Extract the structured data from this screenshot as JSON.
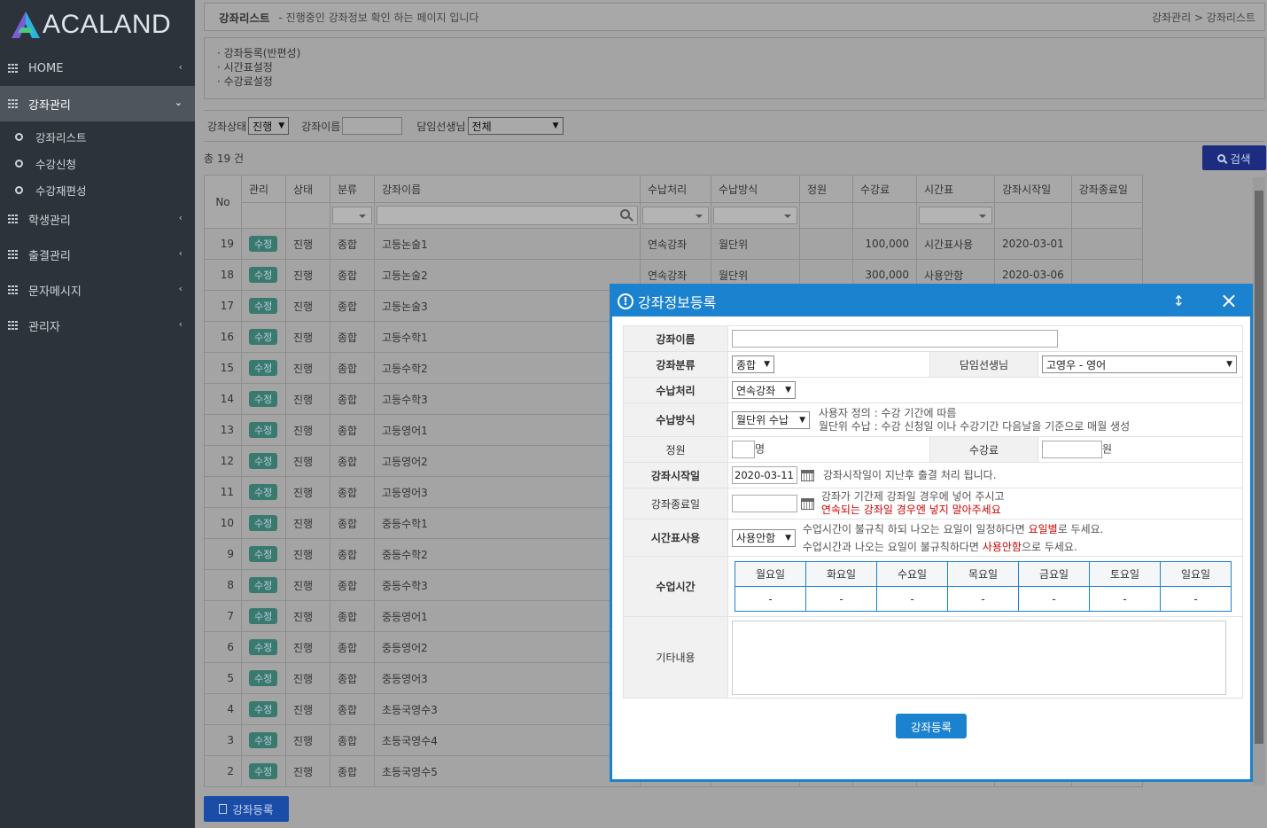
{
  "sidebar": {
    "logo": "ACALAND",
    "items": [
      {
        "label": "HOME"
      },
      {
        "label": "강좌관리"
      },
      {
        "label": "학생관리"
      },
      {
        "label": "출결관리"
      },
      {
        "label": "문자메시지"
      },
      {
        "label": "관리자"
      }
    ],
    "sub_items": [
      {
        "label": "강좌리스트"
      },
      {
        "label": "수강신청"
      },
      {
        "label": "수강재편성"
      }
    ]
  },
  "header": {
    "title": "강좌리스트",
    "desc": "-  진행중인 강좌정보 확인 하는 페이지 입니다",
    "breadcrumb": "강좌관리 > 강좌리스트"
  },
  "links": [
    "· 강좌등록(반편성)",
    "· 시간표설정",
    "· 수강료설정"
  ],
  "filters": {
    "status_label": "강좌상태",
    "status_value": "진행",
    "name_label": "강좌이름",
    "teacher_label": "담임선생님",
    "teacher_value": "전체"
  },
  "total": "총 19 건",
  "search_button": "검색",
  "table": {
    "headers": [
      "No",
      "관리",
      "상태",
      "분류",
      "강좌이름",
      "수납처리",
      "수납방식",
      "정원",
      "수강료",
      "시간표",
      "강좌시작일",
      "강좌종료일"
    ],
    "edit_label": "수정",
    "rows": [
      {
        "no": "19",
        "status": "진행",
        "cat": "종합",
        "name": "고등논술1",
        "pay": "연속강좌",
        "method": "월단위",
        "cap": "",
        "fee": "100,000",
        "tt": "시간표사용",
        "start": "2020-03-01",
        "end": ""
      },
      {
        "no": "18",
        "status": "진행",
        "cat": "종합",
        "name": "고등논술2",
        "pay": "연속강좌",
        "method": "월단위",
        "cap": "",
        "fee": "300,000",
        "tt": "사용안함",
        "start": "2020-03-06",
        "end": ""
      },
      {
        "no": "17",
        "status": "진행",
        "cat": "종합",
        "name": "고등논술3"
      },
      {
        "no": "16",
        "status": "진행",
        "cat": "종합",
        "name": "고등수학1"
      },
      {
        "no": "15",
        "status": "진행",
        "cat": "종합",
        "name": "고등수학2"
      },
      {
        "no": "14",
        "status": "진행",
        "cat": "종합",
        "name": "고등수학3"
      },
      {
        "no": "13",
        "status": "진행",
        "cat": "종합",
        "name": "고등영어1"
      },
      {
        "no": "12",
        "status": "진행",
        "cat": "종합",
        "name": "고등영어2"
      },
      {
        "no": "11",
        "status": "진행",
        "cat": "종합",
        "name": "고등영어3"
      },
      {
        "no": "10",
        "status": "진행",
        "cat": "종합",
        "name": "중등수학1"
      },
      {
        "no": "9",
        "status": "진행",
        "cat": "종합",
        "name": "중등수학2"
      },
      {
        "no": "8",
        "status": "진행",
        "cat": "종합",
        "name": "중등수학3"
      },
      {
        "no": "7",
        "status": "진행",
        "cat": "종합",
        "name": "중등영어1"
      },
      {
        "no": "6",
        "status": "진행",
        "cat": "종합",
        "name": "중등영어2"
      },
      {
        "no": "5",
        "status": "진행",
        "cat": "종합",
        "name": "중등영어3"
      },
      {
        "no": "4",
        "status": "진행",
        "cat": "종합",
        "name": "초등국영수3"
      },
      {
        "no": "3",
        "status": "진행",
        "cat": "종합",
        "name": "초등국영수4"
      },
      {
        "no": "2",
        "status": "진행",
        "cat": "종합",
        "name": "초등국영수5"
      }
    ]
  },
  "register_button": "강좌등록",
  "modal": {
    "title": "강좌정보등록",
    "labels": {
      "name": "강좌이름",
      "category": "강좌분류",
      "teacher": "담임선생님",
      "payment": "수납처리",
      "method": "수납방식",
      "capacity": "정원",
      "fee": "수강료",
      "start": "강좌시작일",
      "end": "강좌종료일",
      "timetable": "시간표사용",
      "class_time": "수업시간",
      "etc": "기타내용"
    },
    "category_value": "종합",
    "teacher_value": "고영우 - 영어",
    "payment_value": "연속강좌",
    "method_value": "월단위 수납",
    "method_note1": "사용자 정의 : 수강 기간에 따름",
    "method_note2": "월단위 수납 : 수강 신청일 이나 수강기간 다음날을 기준으로 매월 생성",
    "capacity_unit": "명",
    "fee_unit": "원",
    "start_value": "2020-03-11",
    "start_note": "강좌시작일이 지난후 출결 처리 됩니다.",
    "end_note1": "강좌가 기간제 강좌일 경우에 넣어 주시고",
    "end_note2": "연속되는 강좌일 경우엔 넣지 말아주세요",
    "timetable_value": "사용안함",
    "tt_note1_a": "수업시간이 불규칙 하되 나오는 요일이 일정하다면 ",
    "tt_note1_b": "요일별",
    "tt_note1_c": "로 두세요.",
    "tt_note2_a": "수업시간과 나오는 요일이 불규칙하다면 ",
    "tt_note2_b": "사용안함",
    "tt_note2_c": "으로 두세요.",
    "days": [
      "월요일",
      "화요일",
      "수요일",
      "목요일",
      "금요일",
      "토요일",
      "일요일"
    ],
    "day_value": "-",
    "submit": "강좌등록"
  }
}
